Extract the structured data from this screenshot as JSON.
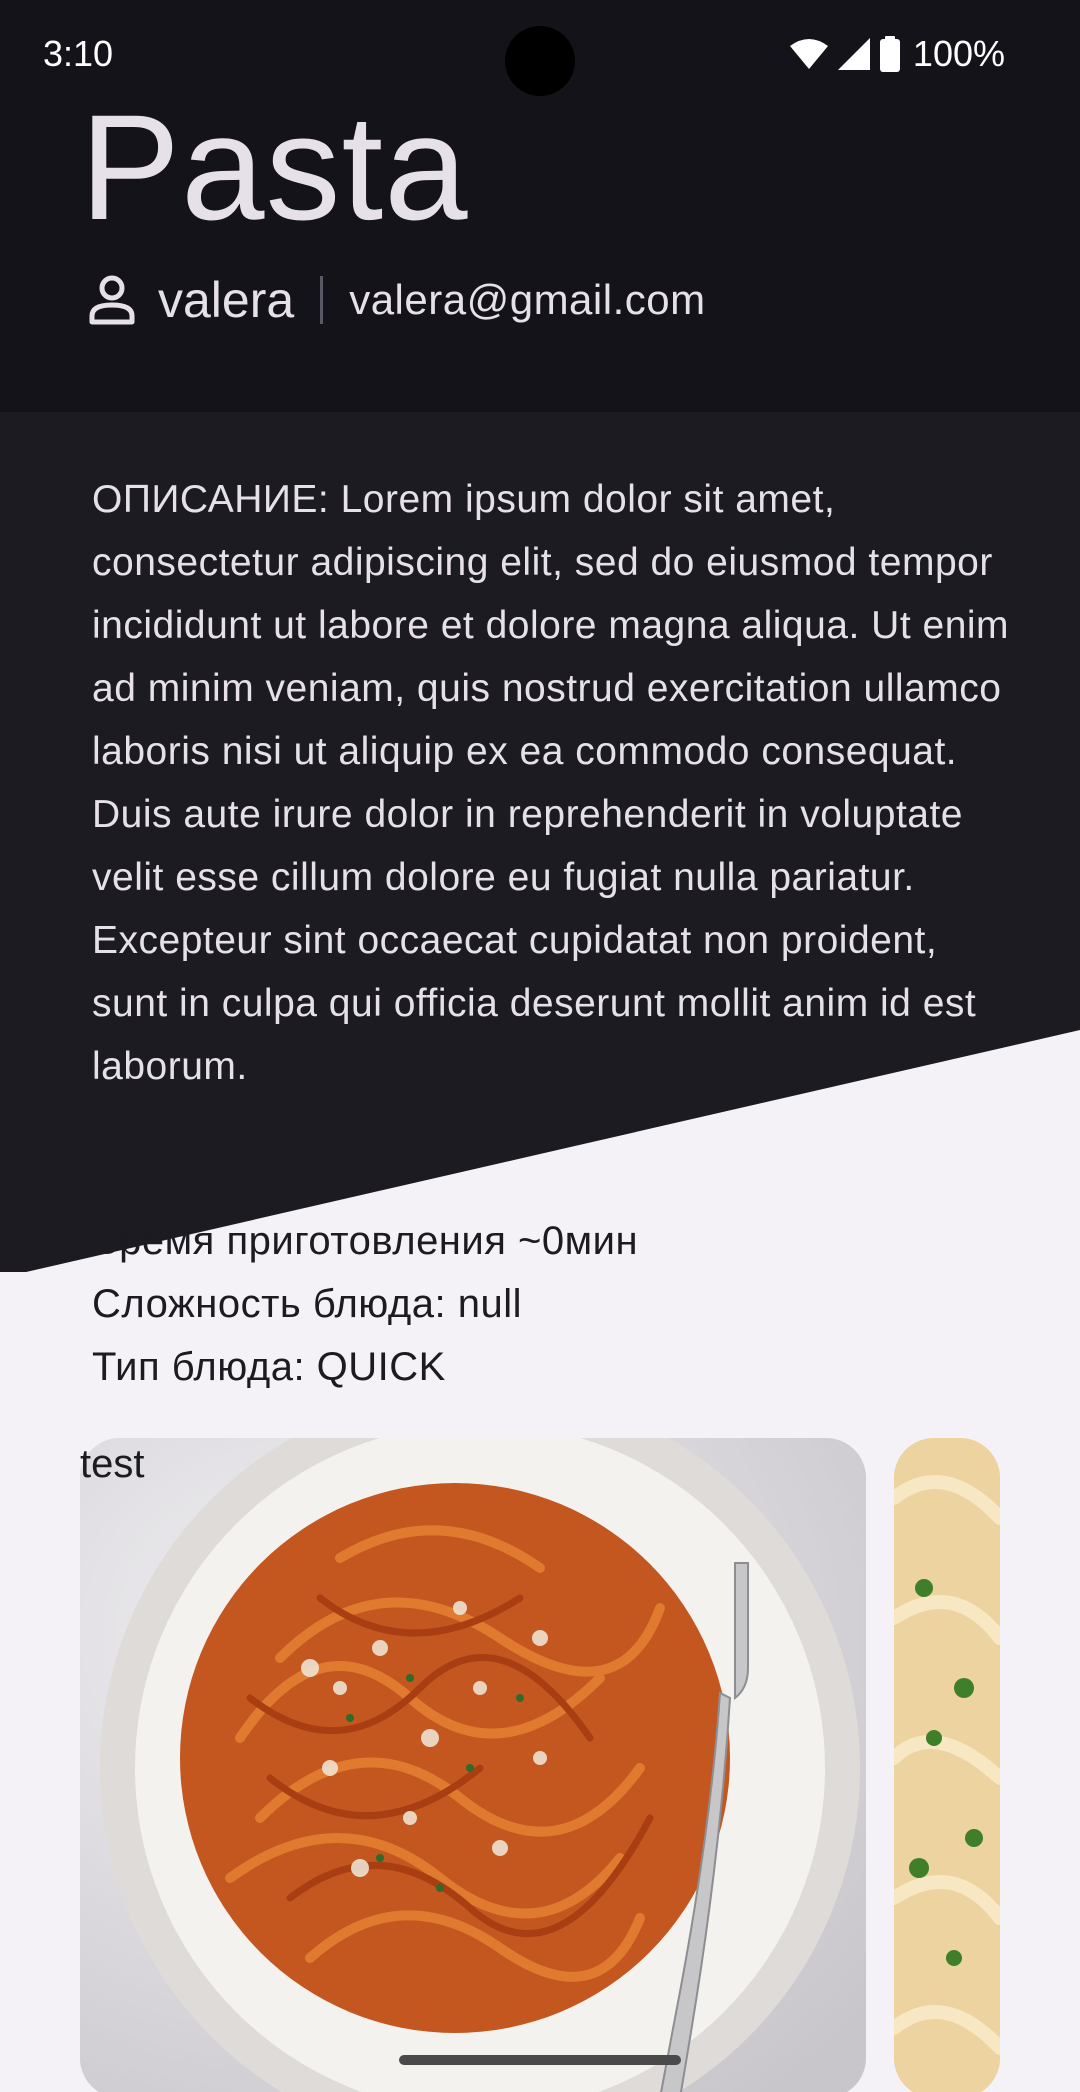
{
  "status_bar": {
    "time": "3:10",
    "battery_percent": "100%",
    "icons": [
      "wifi-icon",
      "signal-icon",
      "battery-icon"
    ]
  },
  "recipe": {
    "title": "Pasta",
    "author_name": "valera",
    "author_email": "valera@gmail.com",
    "description": "ОПИСАНИЕ: Lorem ipsum dolor sit amet, consectetur adipiscing elit, sed do eiusmod tempor incididunt ut labore et dolore magna aliqua. Ut enim ad minim veniam, quis nostrud exercitation ullamco laboris nisi ut aliquip ex ea commodo consequat. Duis aute irure dolor in reprehenderit in voluptate velit esse cillum dolore eu fugiat nulla pariatur. Excepteur sint occaecat cupidatat non proident, sunt in culpa qui officia deserunt mollit anim id est laborum.",
    "cook_time": "Время приготовления ~0мин",
    "difficulty": "Сложность блюда: null",
    "dish_type": "Тип блюда: QUICK"
  },
  "gallery": {
    "first_card_label": "test",
    "images": [
      "spaghetti-photo",
      "fettuccine-photo"
    ]
  },
  "colors": {
    "header_bg": "#141319",
    "description_bg": "#1c1b21",
    "page_bg": "#f5f2f7",
    "text_light": "#e6e0e9",
    "text_dark": "#1c1b21"
  }
}
